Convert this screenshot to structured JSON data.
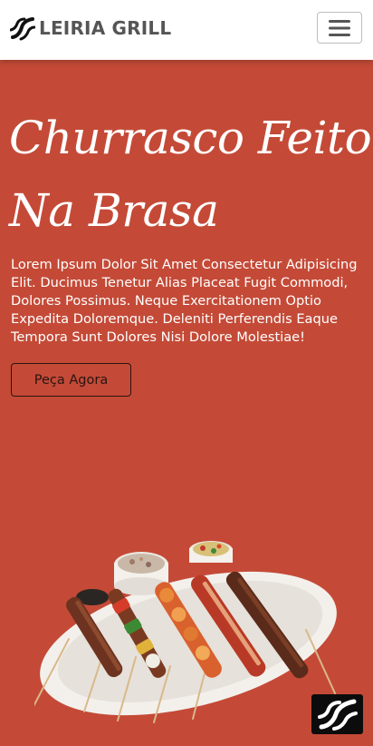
{
  "navbar": {
    "brand_name": "LEIRIA GRILL",
    "brand_icon": "grill-skewer-icon",
    "menu_icon": "hamburger-menu-icon"
  },
  "hero": {
    "title_line1": "Churrasco Feito",
    "title_line2": "Na Brasa",
    "description": "Lorem Ipsum Dolor Sit Amet Consectetur Adipisicing Elit. Ducimus Tenetur Alias Placeat Fugit Commodi, Dolores Possimus. Neque Exercitationem Optio Expedita Doloremque. Deleniti Perferendis Eaque Tempora Sunt Dolores Nisi Dolore Molestiae!",
    "order_button": "Peça Agora",
    "image": "grilled-skewers-platter"
  },
  "floating_button": {
    "icon": "grill-skewer-icon"
  },
  "colors": {
    "hero_background": "#c44a37",
    "navbar_background": "#ffffff",
    "brand_text": "#555555",
    "button_border": "#2a1410"
  }
}
